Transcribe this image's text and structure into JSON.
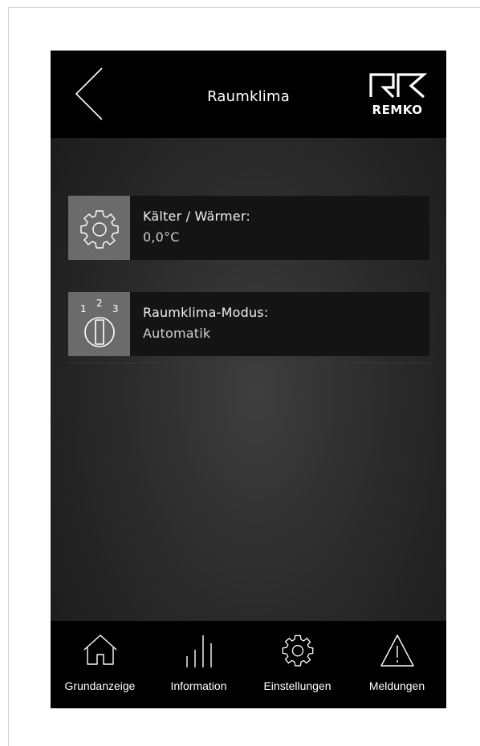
{
  "header": {
    "title": "Raumklima",
    "logo_text": "REMKO"
  },
  "cards": [
    {
      "label": "Kälter / Wärmer:",
      "value": "0,0°C",
      "icon": "gear-icon"
    },
    {
      "label": "Raumklima-Modus:",
      "value": "Automatik",
      "icon": "mode-selector-icon",
      "icon_digits": [
        "1",
        "2",
        "3"
      ]
    }
  ],
  "bottom_nav": {
    "items": [
      {
        "label": "Grundanzeige",
        "icon": "home-icon"
      },
      {
        "label": "Information",
        "icon": "bars-icon"
      },
      {
        "label": "Einstellungen",
        "icon": "gear-icon"
      },
      {
        "label": "Meldungen",
        "icon": "warning-icon"
      }
    ]
  },
  "colors": {
    "header_bg": "#000000",
    "card_bg": "#141414",
    "icon_box_bg": "#6b6b6b",
    "text": "#ffffff"
  }
}
